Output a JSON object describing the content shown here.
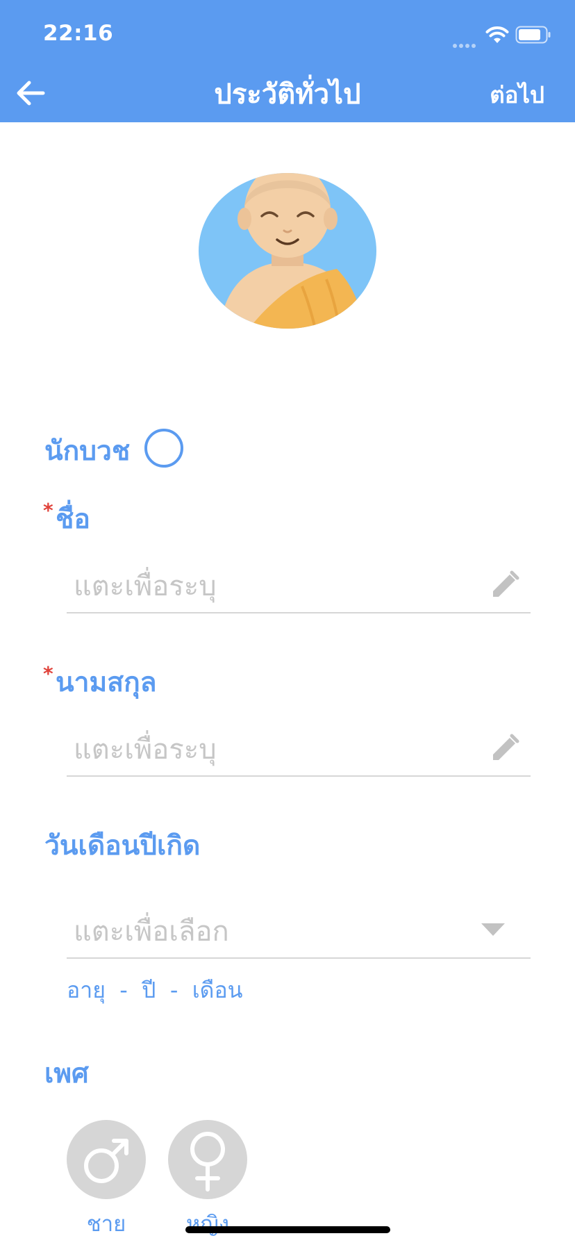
{
  "status_bar": {
    "time": "22:16"
  },
  "header": {
    "title": "ประวัติทั่วไป",
    "next_label": "ต่อไป"
  },
  "colors": {
    "accent": "#5b9bf0",
    "required": "#e0433b",
    "placeholder": "#c6c6c6",
    "gender_inactive": "#d6d6d6"
  },
  "avatar": {
    "icon": "monk-avatar-icon"
  },
  "form": {
    "monk_label": "นักบวช",
    "first_name": {
      "required_mark": "*",
      "label": "ชื่อ",
      "placeholder": "แตะเพื่อระบุ"
    },
    "last_name": {
      "required_mark": "*",
      "label": "นามสกุล",
      "placeholder": "แตะเพื่อระบุ"
    },
    "birthdate": {
      "label": "วันเดือนปีเกิด",
      "placeholder": "แตะเพื่อเลือก"
    },
    "age": {
      "prefix": "อายุ",
      "years_value": "-",
      "years_unit": "ปี",
      "months_value": "-",
      "months_unit": "เดือน"
    },
    "gender": {
      "label": "เพศ",
      "male_label": "ชาย",
      "female_label": "หญิง"
    }
  }
}
